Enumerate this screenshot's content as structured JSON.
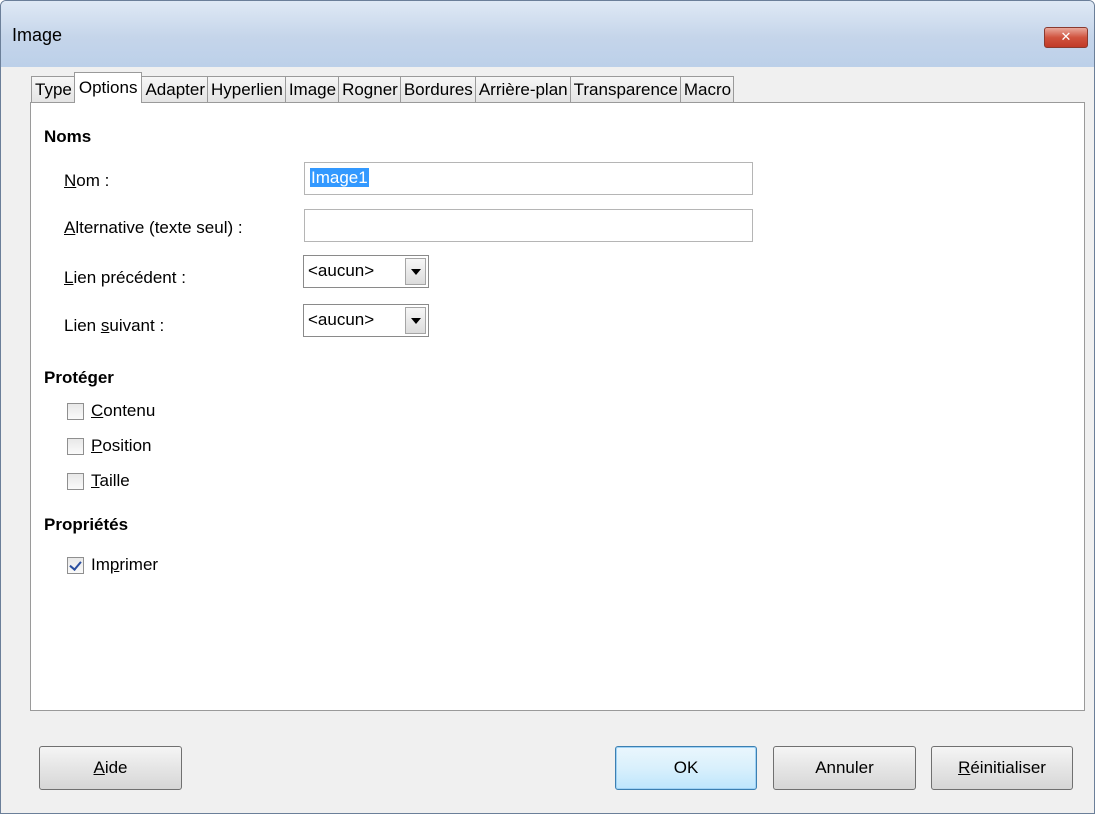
{
  "window": {
    "title": "Image",
    "close_label": "✕"
  },
  "tabs": [
    {
      "label": "Type"
    },
    {
      "label": "Options"
    },
    {
      "label": "Adapter"
    },
    {
      "label": "Hyperlien"
    },
    {
      "label": "Image"
    },
    {
      "label": "Rogner"
    },
    {
      "label": "Bordures"
    },
    {
      "label": "Arrière-plan"
    },
    {
      "label": "Transparence"
    },
    {
      "label": "Macro"
    }
  ],
  "active_tab": "Options",
  "names": {
    "section_title": "Noms",
    "name_label_u": "N",
    "name_label_rest": "om :",
    "name_value": "Image1",
    "alt_label_u": "A",
    "alt_label_rest": "lternative (texte seul) :",
    "alt_value": "",
    "prev_label_u": "L",
    "prev_label_rest": "ien précédent :",
    "prev_value": "<aucun>",
    "next_label_pre": "Lien ",
    "next_label_u": "s",
    "next_label_rest": "uivant :",
    "next_value": "<aucun>"
  },
  "protect": {
    "section_title": "Protéger",
    "items": [
      {
        "u": "C",
        "rest": "ontenu",
        "checked": false
      },
      {
        "u": "P",
        "rest": "osition",
        "checked": false
      },
      {
        "u": "T",
        "rest": "aille",
        "checked": false
      }
    ]
  },
  "properties": {
    "section_title": "Propriétés",
    "print_pre": "Im",
    "print_u": "p",
    "print_rest": "rimer",
    "print_checked": true
  },
  "buttons": {
    "help_u": "A",
    "help_rest": "ide",
    "ok": "OK",
    "cancel": "Annuler",
    "reset_u": "R",
    "reset_rest": "éinitialiser"
  }
}
